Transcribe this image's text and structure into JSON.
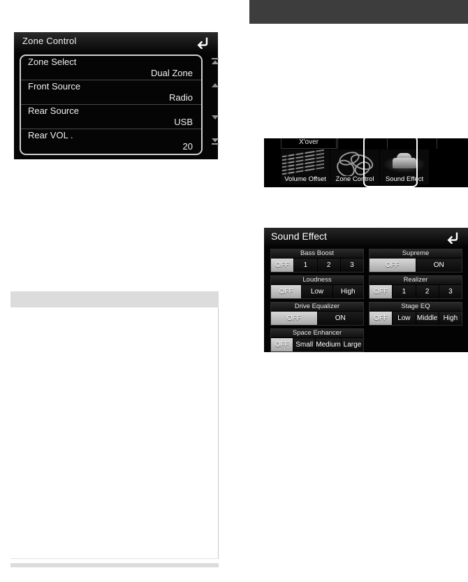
{
  "zone_control": {
    "title": "Zone Control",
    "back_icon": "back-arrow-icon",
    "rows": [
      {
        "label": "Zone Select",
        "value": "Dual Zone"
      },
      {
        "label": "Front Source",
        "value": "Radio"
      },
      {
        "label": "Rear Source",
        "value": "USB"
      },
      {
        "label": "Rear VOL .",
        "value": "20"
      }
    ],
    "scroll_buttons": [
      {
        "name": "scroll-to-top-button",
        "icon": "top-arrow-icon"
      },
      {
        "name": "scroll-up-button",
        "icon": "up-arrow-icon"
      },
      {
        "name": "scroll-down-button",
        "icon": "down-arrow-icon"
      },
      {
        "name": "scroll-to-bottom-button",
        "icon": "bottom-arrow-icon"
      }
    ]
  },
  "icon_strip": {
    "xover_label": "X'over",
    "items": [
      {
        "label": "Volume Offset",
        "icon": "equalizer-thumbnail",
        "selected": false
      },
      {
        "label": "Zone Control",
        "icon": "abstract-shapes-thumbnail",
        "selected": false
      },
      {
        "label": "Sound Effect",
        "icon": "car-interior-thumbnail",
        "selected": true
      }
    ]
  },
  "sound_effect": {
    "title": "Sound Effect",
    "back_icon": "back-arrow-icon",
    "left_groups": [
      {
        "title": "Bass Boost",
        "options": [
          {
            "label": "OFF",
            "selected": true
          },
          {
            "label": "1",
            "selected": false
          },
          {
            "label": "2",
            "selected": false
          },
          {
            "label": "3",
            "selected": false
          }
        ]
      },
      {
        "title": "Loudness",
        "options": [
          {
            "label": "OFF",
            "selected": true
          },
          {
            "label": "Low",
            "selected": false
          },
          {
            "label": "High",
            "selected": false
          }
        ]
      },
      {
        "title": "Drive Equalizer",
        "options": [
          {
            "label": "OFF",
            "selected": true
          },
          {
            "label": "ON",
            "selected": false
          }
        ]
      },
      {
        "title": "Space Enhancer",
        "options": [
          {
            "label": "OFF",
            "selected": true
          },
          {
            "label": "Small",
            "selected": false
          },
          {
            "label": "Medium",
            "selected": false
          },
          {
            "label": "Large",
            "selected": false
          }
        ]
      }
    ],
    "right_groups": [
      {
        "title": "Supreme",
        "options": [
          {
            "label": "OFF",
            "selected": true
          },
          {
            "label": "ON",
            "selected": false
          }
        ]
      },
      {
        "title": "Realizer",
        "options": [
          {
            "label": "OFF",
            "selected": true
          },
          {
            "label": "1",
            "selected": false
          },
          {
            "label": "2",
            "selected": false
          },
          {
            "label": "3",
            "selected": false
          }
        ]
      },
      {
        "title": "Stage EQ",
        "options": [
          {
            "label": "OFF",
            "selected": true
          },
          {
            "label": "Low",
            "selected": false
          },
          {
            "label": "Middle",
            "selected": false
          },
          {
            "label": "High",
            "selected": false
          }
        ]
      }
    ]
  },
  "colors": {
    "panel_background": "#050505",
    "selected_option": "#cccccc",
    "text": "#ffffff",
    "doc_bar": "#dcdcdc",
    "top_bar": "#3d3d3d"
  }
}
